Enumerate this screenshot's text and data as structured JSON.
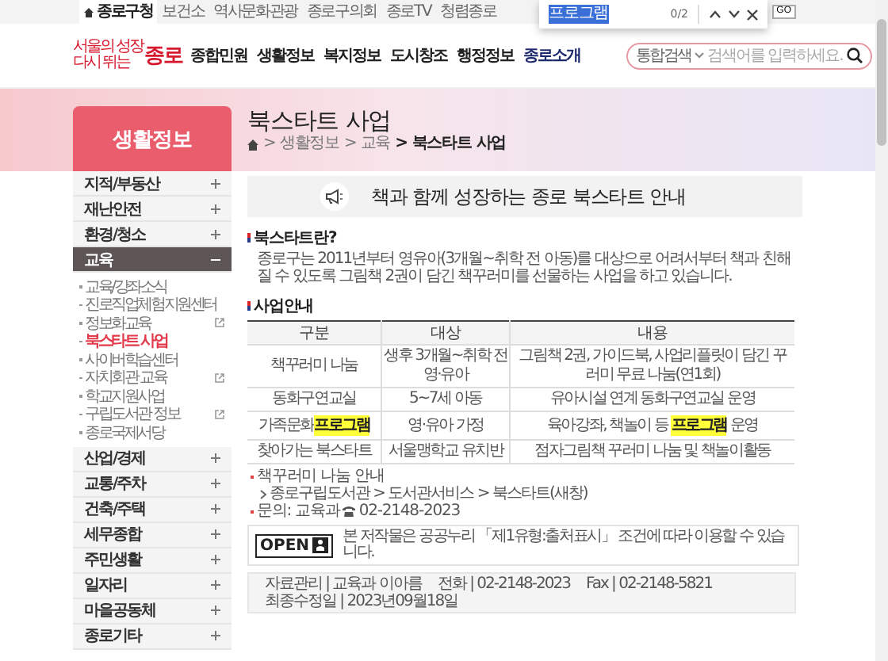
{
  "top_bar": {
    "links": [
      {
        "label": "종로구청",
        "selected": true
      },
      {
        "label": "보건소",
        "selected": false
      },
      {
        "label": "역사문화관광",
        "selected": false
      },
      {
        "label": "종로구의회",
        "selected": false
      },
      {
        "label": "종로TV",
        "selected": false
      },
      {
        "label": "청렴종로",
        "selected": false
      }
    ],
    "go_button": "GO"
  },
  "find_bar": {
    "query": "프로그램",
    "count": "0/2"
  },
  "header": {
    "logo": {
      "line_1": "서울의 성장",
      "line_2": "다시 뛰는",
      "name": "종로"
    },
    "nav": [
      {
        "label": "종합민원",
        "selected": false
      },
      {
        "label": "생활정보",
        "selected": false
      },
      {
        "label": "복지정보",
        "selected": false
      },
      {
        "label": "도시창조",
        "selected": false
      },
      {
        "label": "행정정보",
        "selected": false
      },
      {
        "label": "종로소개",
        "selected": true
      }
    ],
    "search": {
      "scope": "통합검색",
      "placeholder": "검색어를 입력하세요."
    }
  },
  "sidebar": {
    "title": "생활정보",
    "items": [
      {
        "label": "지적/부동산",
        "expanded": false
      },
      {
        "label": "재난안전",
        "expanded": false
      },
      {
        "label": "환경/청소",
        "expanded": false
      },
      {
        "label": "교육",
        "expanded": true,
        "children": [
          {
            "label": "교육/강좌소식",
            "selected": false,
            "external": false
          },
          {
            "label": "진로직업체험지원센터",
            "selected": false,
            "external": false
          },
          {
            "label": "정보화교육",
            "selected": false,
            "external": true
          },
          {
            "label": "북스타트 사업",
            "selected": true,
            "external": false
          },
          {
            "label": "사이버학습센터",
            "selected": false,
            "external": false
          },
          {
            "label": "자치회관 교육",
            "selected": false,
            "external": true
          },
          {
            "label": "학교지원사업",
            "selected": false,
            "external": false
          },
          {
            "label": "구립도서관 정보",
            "selected": false,
            "external": true
          },
          {
            "label": "종로국제서당",
            "selected": false,
            "external": false
          }
        ]
      },
      {
        "label": "산업/경제",
        "expanded": false
      },
      {
        "label": "교통/주차",
        "expanded": false
      },
      {
        "label": "건축/주택",
        "expanded": false
      },
      {
        "label": "세무종합",
        "expanded": false
      },
      {
        "label": "주민생활",
        "expanded": false
      },
      {
        "label": "일자리",
        "expanded": false
      },
      {
        "label": "마을공동체",
        "expanded": false
      },
      {
        "label": "종로기타",
        "expanded": false
      }
    ]
  },
  "page": {
    "title": "북스타트 사업",
    "breadcrumb": [
      "> 생활정보",
      "> 교육",
      "> 북스타트 사업"
    ],
    "banner": "책과 함께 성장하는 종로 북스타트 안내",
    "intro": {
      "heading": "북스타트란?",
      "text": "종로구는 2011년부터 영유아(3개월~취학 전 아동)를 대상으로 어려서부터 책과 친해질 수 있도록 그림책 2권이 담긴 책꾸러미를 선물하는 사업을 하고 있습니다."
    },
    "program": {
      "heading": "사업안내",
      "columns": [
        "구분",
        "대상",
        "내용"
      ],
      "rows": [
        [
          [
            {
              "text": "책꾸러미 나눔",
              "highlighted": false
            }
          ],
          [
            {
              "text": "생후 3개월~취학 전 영·유아",
              "highlighted": false
            }
          ],
          [
            {
              "text": "그림책 2권, 가이드북, 사업리플릿이 담긴 꾸러미 무료 나눔(연1회)",
              "highlighted": false
            }
          ]
        ],
        [
          [
            {
              "text": "동화구연교실",
              "highlighted": false
            }
          ],
          [
            {
              "text": "5~7세 아동",
              "highlighted": false
            }
          ],
          [
            {
              "text": "유아시설 연계 동화구연교실 운영",
              "highlighted": false
            }
          ]
        ],
        [
          [
            {
              "text": "가족문화",
              "highlighted": false
            },
            {
              "text": "프로그램",
              "highlighted": true
            }
          ],
          [
            {
              "text": "영·유아 가정",
              "highlighted": false
            }
          ],
          [
            {
              "text": "육아강좌, 책놀이 등 ",
              "highlighted": false
            },
            {
              "text": "프로그램",
              "highlighted": true
            },
            {
              "text": " 운영",
              "highlighted": false
            }
          ]
        ],
        [
          [
            {
              "text": "찾아가는 북스타트",
              "highlighted": false
            }
          ],
          [
            {
              "text": "서울맹학교 유치반",
              "highlighted": false
            }
          ],
          [
            {
              "text": "점자그림책 꾸러미 나눔 및 책놀이활동",
              "highlighted": false
            }
          ]
        ]
      ]
    },
    "notes": [
      {
        "kind": "note",
        "text": "책꾸러미 나눔 안내"
      },
      {
        "kind": "link",
        "text": "종로구립도서관 > 도서관서비스 > 북스타트(새창)"
      },
      {
        "kind": "contact",
        "text": "문의: 교육과",
        "phone": "02-2148-2023"
      }
    ],
    "license": {
      "logo": "OPEN",
      "text": "본 저작물은 공공누리 「제1유형:출처표시」 조건에 따라 이용할 수 있습니다."
    },
    "info": [
      "자료관리 | 교육과 이아름",
      "전화 | 02-2148-2023",
      "Fax | 02-2148-5821",
      "최종수정일 | 2023년09월18일"
    ]
  }
}
